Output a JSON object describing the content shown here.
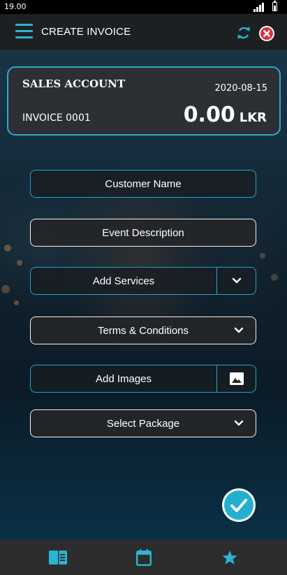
{
  "status_bar": {
    "time": "19.00"
  },
  "app_bar": {
    "title": "CREATE INVOICE"
  },
  "account_card": {
    "account_name": "SALES ACCOUNT",
    "date": "2020-08-15",
    "invoice_number": "INVOICE 0001",
    "total_amount": "0.00",
    "currency": "LKR"
  },
  "form": {
    "customer_name": "Customer Name",
    "event_description": "Event Description",
    "add_services": "Add Services",
    "terms_conditions": "Terms & Conditions",
    "add_images": "Add Images",
    "select_package": "Select Package"
  },
  "icons": {
    "menu": "menu-icon",
    "refresh": "refresh-icon",
    "close": "close-icon",
    "chevron": "chevron-down-icon",
    "image": "image-icon",
    "submit": "check-icon",
    "nav": [
      "invoice-icon",
      "calendar-icon",
      "star-icon"
    ]
  },
  "colors": {
    "accent": "#2ab4d4",
    "close": "#d73443",
    "card_bg": "#2c3034",
    "app_bar_bg": "#1d2023",
    "bottom_nav_bg": "#2d2d2d"
  }
}
